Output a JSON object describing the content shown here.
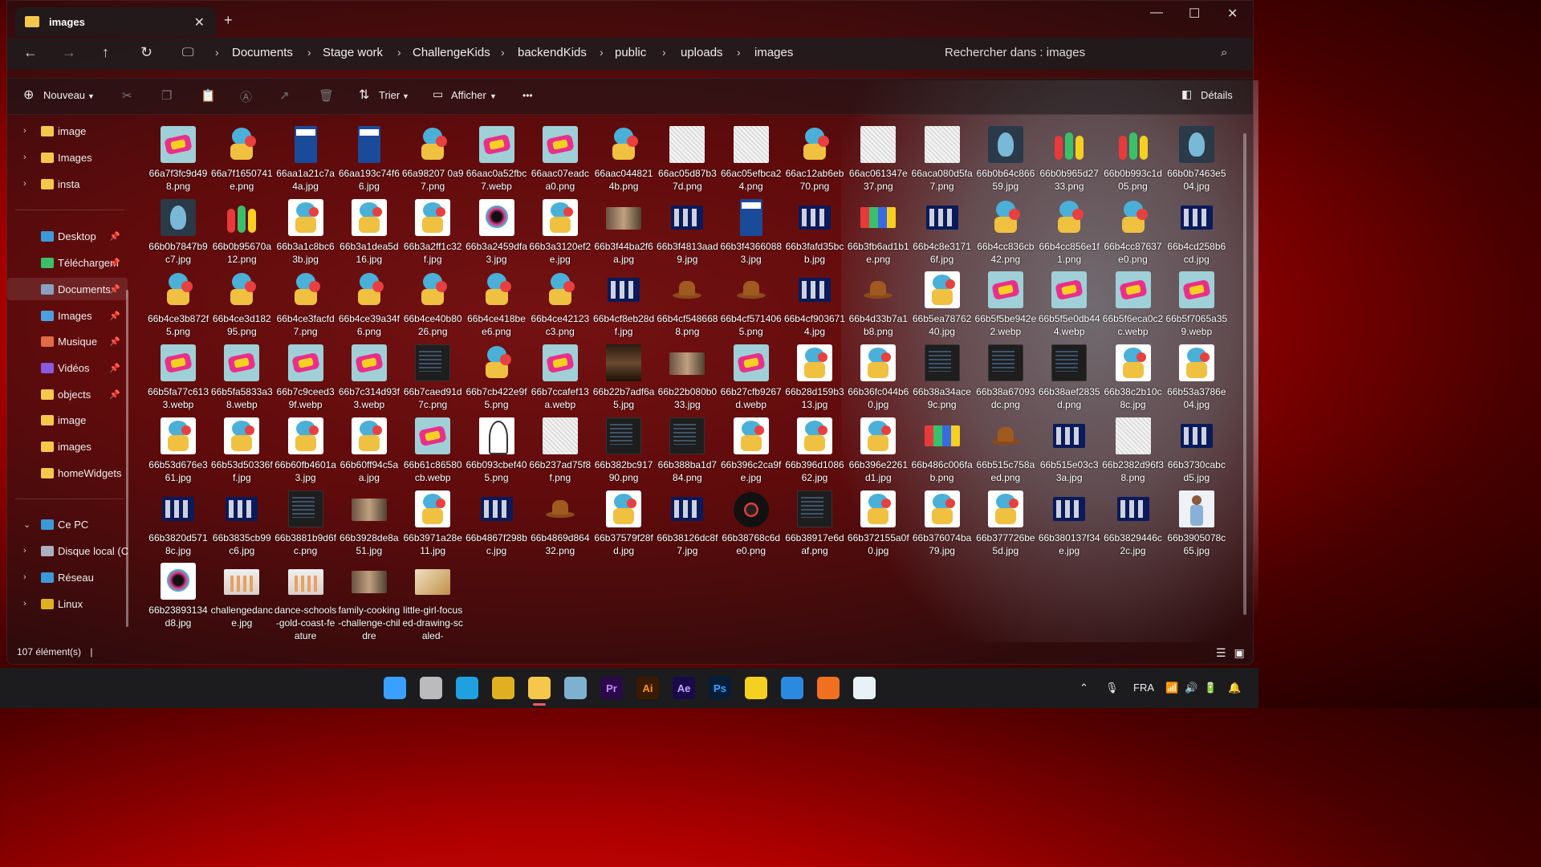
{
  "window": {
    "tab_title": "images",
    "tab_close": "✕",
    "new_tab": "+",
    "minimize": "—",
    "maximize": "☐",
    "close": "✕"
  },
  "address": {
    "back": "←",
    "forward": "→",
    "up": "↑",
    "refresh": "↻",
    "breadcrumbs": [
      "Documents",
      "Stage work",
      "ChallengeKids",
      "backendKids",
      "public",
      "uploads",
      "images"
    ],
    "separator": "›",
    "search_placeholder": "Rechercher dans : images"
  },
  "toolbar": {
    "new_label": "Nouveau",
    "sort_label": "Trier",
    "view_label": "Afficher",
    "more": "•••",
    "details_label": "Détails"
  },
  "sidebar": {
    "items": [
      {
        "label": "image",
        "icon": "folder-icon",
        "chevron": "›"
      },
      {
        "label": "Images",
        "icon": "folder-icon",
        "chevron": "›"
      },
      {
        "label": "insta",
        "icon": "folder-icon",
        "chevron": "›"
      },
      {
        "label": "Desktop",
        "icon": "desktop-icon",
        "pin": "📌"
      },
      {
        "label": "Téléchargem",
        "icon": "download-icon",
        "pin": "📌"
      },
      {
        "label": "Documents",
        "icon": "documents-icon",
        "pin": "📌"
      },
      {
        "label": "Images",
        "icon": "pictures-icon",
        "pin": "📌"
      },
      {
        "label": "Musique",
        "icon": "music-icon",
        "pin": "📌"
      },
      {
        "label": "Vidéos",
        "icon": "videos-icon",
        "pin": "📌"
      },
      {
        "label": "objects",
        "icon": "folder-icon",
        "pin": "📌"
      },
      {
        "label": "image",
        "icon": "folder-icon"
      },
      {
        "label": "images",
        "icon": "folder-icon"
      },
      {
        "label": "homeWidgets",
        "icon": "folder-icon"
      },
      {
        "label": "Ce PC",
        "icon": "pc-icon",
        "chevron": "⌄"
      },
      {
        "label": "Disque local (C",
        "icon": "drive-icon",
        "chevron": "›"
      },
      {
        "label": "Réseau",
        "icon": "network-icon",
        "chevron": "›"
      },
      {
        "label": "Linux",
        "icon": "linux-icon",
        "chevron": "›"
      }
    ]
  },
  "files": [
    {
      "name": "66a7f3fc9d498.png",
      "kind": "kids"
    },
    {
      "name": "66a7f1650741e.png",
      "kind": "mascot"
    },
    {
      "name": "66aa1a21c7a4a.jpg",
      "kind": "book"
    },
    {
      "name": "66aa193c74f66.jpg",
      "kind": "book"
    },
    {
      "name": "66a98207 0a97.png",
      "kind": "mascot"
    },
    {
      "name": "66aac0a52fbc7.webp",
      "kind": "kids"
    },
    {
      "name": "66aac07eadca0.png",
      "kind": "kids"
    },
    {
      "name": "66aac0448214b.png",
      "kind": "mascot"
    },
    {
      "name": "66ac05d87b37d.png",
      "kind": "doodle"
    },
    {
      "name": "66ac05efbca24.png",
      "kind": "doodle"
    },
    {
      "name": "66ac12ab6eb70.png",
      "kind": "mascot"
    },
    {
      "name": "66ac061347e37.png",
      "kind": "doodle"
    },
    {
      "name": "66aca080d5fa7.png",
      "kind": "doodle"
    },
    {
      "name": "66b0b64c86659.jpg",
      "kind": "dolphin"
    },
    {
      "name": "66b0b965d2733.png",
      "kind": "children"
    },
    {
      "name": "66b0b993c1d05.png",
      "kind": "children"
    },
    {
      "name": "66b0b7463e504.jpg",
      "kind": "dolphin"
    },
    {
      "name": "66b0b7847b9c7.jpg",
      "kind": "dolphin"
    },
    {
      "name": "66b0b95670a12.png",
      "kind": "children"
    },
    {
      "name": "66b3a1c8bc63b.jpg",
      "kind": "mascot2"
    },
    {
      "name": "66b3a1dea5d16.jpg",
      "kind": "mascot2"
    },
    {
      "name": "66b3a2ff1c32f.jpg",
      "kind": "mascot2"
    },
    {
      "name": "66b3a2459dfa3.jpg",
      "kind": "splash"
    },
    {
      "name": "66b3a3120ef2e.jpg",
      "kind": "mascot2"
    },
    {
      "name": "66b3f44ba2f6a.jpg",
      "kind": "photo"
    },
    {
      "name": "66b3f4813aad9.jpg",
      "kind": "icons"
    },
    {
      "name": "66b3f43660883.jpg",
      "kind": "book"
    },
    {
      "name": "66b3fafd35bcb.jpg",
      "kind": "icons"
    },
    {
      "name": "66b3fb6ad1b1e.png",
      "kind": "collage"
    },
    {
      "name": "66b4c8e31716f.jpg",
      "kind": "icons"
    },
    {
      "name": "66b4cc836cb42.png",
      "kind": "mascot"
    },
    {
      "name": "66b4cc856e1f1.png",
      "kind": "mascot"
    },
    {
      "name": "66b4cc87637e0.png",
      "kind": "mascot"
    },
    {
      "name": "66b4cd258b6cd.jpg",
      "kind": "icons"
    },
    {
      "name": "66b4ce3b872f5.png",
      "kind": "mascot"
    },
    {
      "name": "66b4ce3d18295.png",
      "kind": "mascot"
    },
    {
      "name": "66b4ce3facfd7.png",
      "kind": "mascot"
    },
    {
      "name": "66b4ce39a34f6.png",
      "kind": "mascot"
    },
    {
      "name": "66b4ce40b8026.png",
      "kind": "mascot"
    },
    {
      "name": "66b4ce418bee6.png",
      "kind": "mascot"
    },
    {
      "name": "66b4ce42123c3.png",
      "kind": "mascot"
    },
    {
      "name": "66b4cf8eb28df.jpg",
      "kind": "icons"
    },
    {
      "name": "66b4cf5486688.png",
      "kind": "hat"
    },
    {
      "name": "66b4cf5714065.png",
      "kind": "hat"
    },
    {
      "name": "66b4cf9036714.jpg",
      "kind": "icons"
    },
    {
      "name": "66b4d33b7a1b8.png",
      "kind": "hat"
    },
    {
      "name": "66b5ea7876240.jpg",
      "kind": "mascot2"
    },
    {
      "name": "66b5f5be942e2.webp",
      "kind": "kids"
    },
    {
      "name": "66b5f5e0db444.webp",
      "kind": "kids"
    },
    {
      "name": "66b5f6eca0c2c.webp",
      "kind": "kids"
    },
    {
      "name": "66b5f7065a359.webp",
      "kind": "kids"
    },
    {
      "name": "66b5fa77c6133.webp",
      "kind": "kids"
    },
    {
      "name": "66b5fa5833a38.webp",
      "kind": "kids"
    },
    {
      "name": "66b7c9ceed39f.webp",
      "kind": "kids"
    },
    {
      "name": "66b7c314d93f3.webp",
      "kind": "kids"
    },
    {
      "name": "66b7caed91d7c.png",
      "kind": "code"
    },
    {
      "name": "66b7cb422e9f5.png",
      "kind": "mascot"
    },
    {
      "name": "66b7ccafef13a.webp",
      "kind": "kids"
    },
    {
      "name": "66b22b7adf6a5.jpg",
      "kind": "dark"
    },
    {
      "name": "66b22b080b033.jpg",
      "kind": "photo"
    },
    {
      "name": "66b27cfb9267d.webp",
      "kind": "kids"
    },
    {
      "name": "66b28d159b313.jpg",
      "kind": "mascot2"
    },
    {
      "name": "66b36fc044b60.jpg",
      "kind": "mascot2"
    },
    {
      "name": "66b38a34ace9c.png",
      "kind": "code"
    },
    {
      "name": "66b38a67093dc.png",
      "kind": "code"
    },
    {
      "name": "66b38aef2835d.png",
      "kind": "code"
    },
    {
      "name": "66b38c2b10c8c.jpg",
      "kind": "mascot2"
    },
    {
      "name": "66b53a3786e04.jpg",
      "kind": "mascot2"
    },
    {
      "name": "66b53d676e361.jpg",
      "kind": "mascot2"
    },
    {
      "name": "66b53d50336ff.jpg",
      "kind": "mascot2"
    },
    {
      "name": "66b60fb4601a3.jpg",
      "kind": "mascot2"
    },
    {
      "name": "66b60ff94c5aa.jpg",
      "kind": "mascot2"
    },
    {
      "name": "66b61c86580cb.webp",
      "kind": "kids"
    },
    {
      "name": "66b093cbef405.png",
      "kind": "sketch"
    },
    {
      "name": "66b237ad75f8f.png",
      "kind": "doodle"
    },
    {
      "name": "66b382bc91790.png",
      "kind": "code"
    },
    {
      "name": "66b388ba1d784.png",
      "kind": "code"
    },
    {
      "name": "66b396c2ca9fe.jpg",
      "kind": "mascot2"
    },
    {
      "name": "66b396d108662.jpg",
      "kind": "mascot2"
    },
    {
      "name": "66b396e2261d1.jpg",
      "kind": "mascot2"
    },
    {
      "name": "66b486c006fab.png",
      "kind": "collage"
    },
    {
      "name": "66b515c758aed.png",
      "kind": "hat"
    },
    {
      "name": "66b515e03c33a.jpg",
      "kind": "icons"
    },
    {
      "name": "66b2382d96f38.png",
      "kind": "doodle"
    },
    {
      "name": "66b3730cabcd5.jpg",
      "kind": "icons"
    },
    {
      "name": "66b3820d5718c.jpg",
      "kind": "icons"
    },
    {
      "name": "66b3835cb99c6.jpg",
      "kind": "icons"
    },
    {
      "name": "66b3881b9d6fc.png",
      "kind": "code"
    },
    {
      "name": "66b3928de8a51.jpg",
      "kind": "photo"
    },
    {
      "name": "66b3971a28e11.jpg",
      "kind": "mascot2"
    },
    {
      "name": "66b4867f298bc.jpg",
      "kind": "icons"
    },
    {
      "name": "66b4869d86432.png",
      "kind": "hat"
    },
    {
      "name": "66b37579f28fd.jpg",
      "kind": "mascot2"
    },
    {
      "name": "66b38126dc8f7.jpg",
      "kind": "icons"
    },
    {
      "name": "66b38768c6de0.png",
      "kind": "ball"
    },
    {
      "name": "66b38917e6daf.png",
      "kind": "code"
    },
    {
      "name": "66b372155a0f0.jpg",
      "kind": "mascot2"
    },
    {
      "name": "66b376074ba79.jpg",
      "kind": "mascot2"
    },
    {
      "name": "66b377726be5d.jpg",
      "kind": "mascot2"
    },
    {
      "name": "66b380137f34e.jpg",
      "kind": "icons"
    },
    {
      "name": "66b3829446c2c.jpg",
      "kind": "icons"
    },
    {
      "name": "66b3905078c65.jpg",
      "kind": "girl"
    },
    {
      "name": "66b23893134d8.jpg",
      "kind": "splash"
    },
    {
      "name": "challengedance.jpg",
      "kind": "dance"
    },
    {
      "name": "dance-schools-gold-coast-feature",
      "kind": "dance"
    },
    {
      "name": "family-cooking-challenge-childre",
      "kind": "photo"
    },
    {
      "name": "little-girl-focused-drawing-scaled-",
      "kind": "drawing"
    }
  ],
  "status": {
    "count": "107 élément(s)",
    "divider": "|"
  },
  "taskbar": {
    "apps": [
      {
        "name": "windows-start-icon",
        "glyph": "",
        "color": "#3aa0ff"
      },
      {
        "name": "task-view-icon",
        "glyph": "",
        "color": "#bbbbbb"
      },
      {
        "name": "edge-icon",
        "glyph": "",
        "color": "#1fa0e0"
      },
      {
        "name": "chrome-icon",
        "glyph": "",
        "color": "#e0b020"
      },
      {
        "name": "file-explorer-icon",
        "glyph": "",
        "color": "#f5c84b"
      },
      {
        "name": "terminal-icon",
        "glyph": "",
        "color": "#7fb0d0"
      },
      {
        "name": "premiere-icon",
        "glyph": "Pr",
        "color": "#2a0a4a"
      },
      {
        "name": "illustrator-icon",
        "glyph": "Ai",
        "color": "#3a1a00"
      },
      {
        "name": "after-effects-icon",
        "glyph": "Ae",
        "color": "#1a0a4a"
      },
      {
        "name": "photoshop-icon",
        "glyph": "Ps",
        "color": "#061e3a"
      },
      {
        "name": "sticky-notes-icon",
        "glyph": "",
        "color": "#f5d020"
      },
      {
        "name": "vscode-icon",
        "glyph": "",
        "color": "#2a8ae0"
      },
      {
        "name": "xampp-icon",
        "glyph": "",
        "color": "#f07020"
      },
      {
        "name": "app-icon",
        "glyph": "",
        "color": "#e8f0f8"
      }
    ],
    "tray": {
      "chevron": "⌃",
      "mic": "🎙",
      "lang": "FRA",
      "wifi": "📶",
      "sound": "🔊",
      "battery": "🔋",
      "bell": "🔔"
    }
  }
}
